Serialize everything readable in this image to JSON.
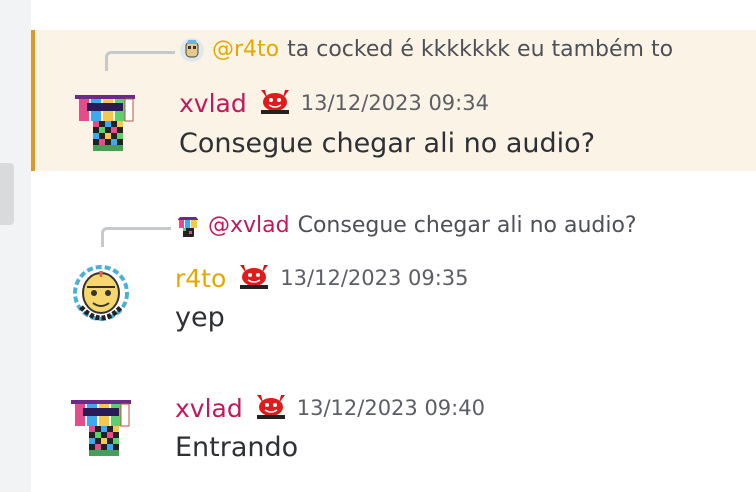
{
  "colors": {
    "xvlad": "#c2185b",
    "r4to": "#e5a800",
    "highlight_bg": "#fbf3e6",
    "highlight_bar": "#d99a27"
  },
  "messages": [
    {
      "reply": {
        "mention": "@r4to",
        "text": "ta cocked é kkkkkkk eu também to"
      },
      "author": "xvlad",
      "timestamp": "13/12/2023 09:34",
      "content": "Consegue chegar ali no audio?"
    },
    {
      "reply": {
        "mention": "@xvlad",
        "text": "Consegue chegar ali no audio?"
      },
      "author": "r4to",
      "timestamp": "13/12/2023 09:35",
      "content": "yep"
    },
    {
      "author": "xvlad",
      "timestamp": "13/12/2023 09:40",
      "content": "Entrando"
    }
  ]
}
